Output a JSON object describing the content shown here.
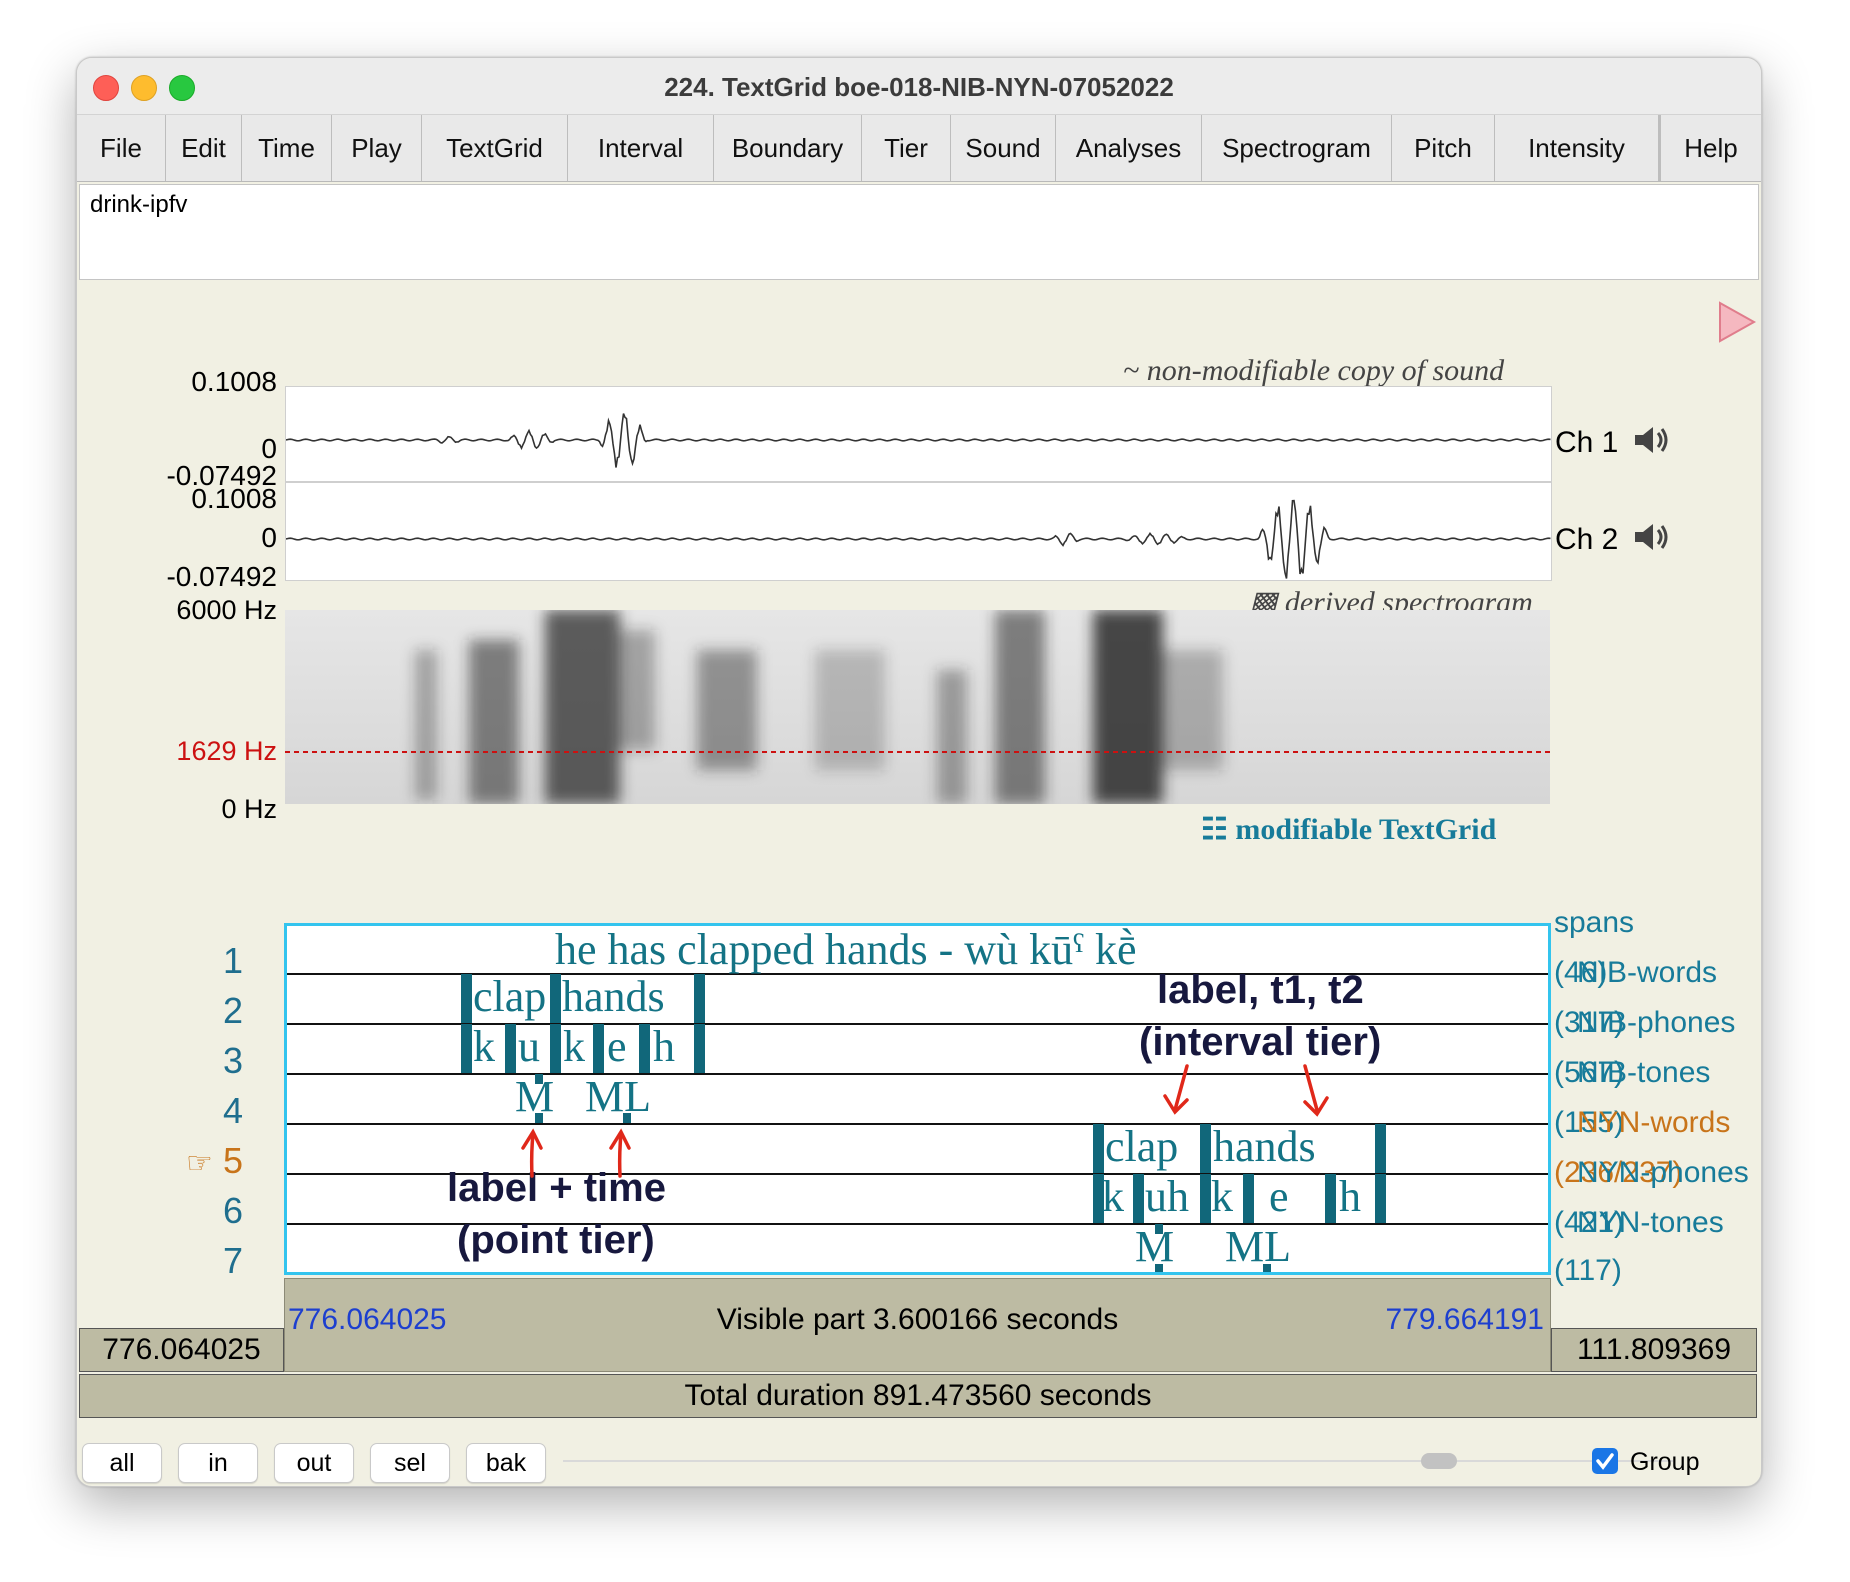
{
  "window": {
    "title": "224. TextGrid boe-018-NIB-NYN-07052022"
  },
  "menu": [
    "File",
    "Edit",
    "Time",
    "Play",
    "TextGrid",
    "Interval",
    "Boundary",
    "Tier",
    "Sound",
    "Analyses",
    "Spectrogram",
    "Pitch",
    "Intensity",
    "Help"
  ],
  "text_field": {
    "value": "drink-ipfv"
  },
  "sound": {
    "note": "~ non-modifiable copy of sound",
    "ch1": {
      "max": "0.1008",
      "zero": "0",
      "min": "-0.07492",
      "label": "Ch 1"
    },
    "ch2": {
      "max": "0.1008",
      "zero": "0",
      "min": "-0.07492",
      "label": "Ch 2"
    },
    "speaker_icon": "speaker-icon"
  },
  "spectrogram": {
    "note": "▩ derived spectrogram",
    "top": "6000 Hz",
    "cursor": "1629 Hz",
    "bottom": "0 Hz",
    "cursor_color": "#cc1111"
  },
  "textgrid": {
    "note": "☷ modifiable TextGrid",
    "selected_tier_marker": "☞",
    "tiers": [
      {
        "num": "1",
        "name": "spans",
        "count": "(46)"
      },
      {
        "num": "2",
        "name": "NIB-words",
        "count": "(317)"
      },
      {
        "num": "3",
        "name": "NIB-phones",
        "count": "(567)"
      },
      {
        "num": "4",
        "name": "NIB-tones",
        "count": "(155)"
      },
      {
        "num": "5",
        "name": "NYN-words",
        "count": "(236/237)"
      },
      {
        "num": "6",
        "name": "NYN-phones",
        "count": "(421)"
      },
      {
        "num": "7",
        "name": "NYN-tones",
        "count": "(117)"
      }
    ],
    "span_text": "he has clapped hands - wù kūˤ kḕ",
    "nib_words": [
      "clap",
      "hands"
    ],
    "nib_phones": [
      "k",
      "u",
      "k",
      "e",
      "h"
    ],
    "nib_tones": [
      "M",
      "ML"
    ],
    "nyn_words": [
      "clap",
      "hands"
    ],
    "nyn_phones": [
      "k",
      "uh",
      "k",
      "e",
      "h"
    ],
    "nyn_tones": [
      "M",
      "ML"
    ],
    "callout_interval": [
      "label, t1, t2",
      "(interval tier)"
    ],
    "callout_point": [
      "label + time",
      "(point tier)"
    ]
  },
  "time": {
    "left_window": "776.064025",
    "visible_start": "776.064025",
    "visible_label": "Visible part 3.600166 seconds",
    "visible_end": "779.664191",
    "right_window": "111.809369",
    "total": "Total duration 891.473560 seconds"
  },
  "buttons": [
    "all",
    "in",
    "out",
    "sel",
    "bak"
  ],
  "group": {
    "label": "Group",
    "checked": true
  }
}
